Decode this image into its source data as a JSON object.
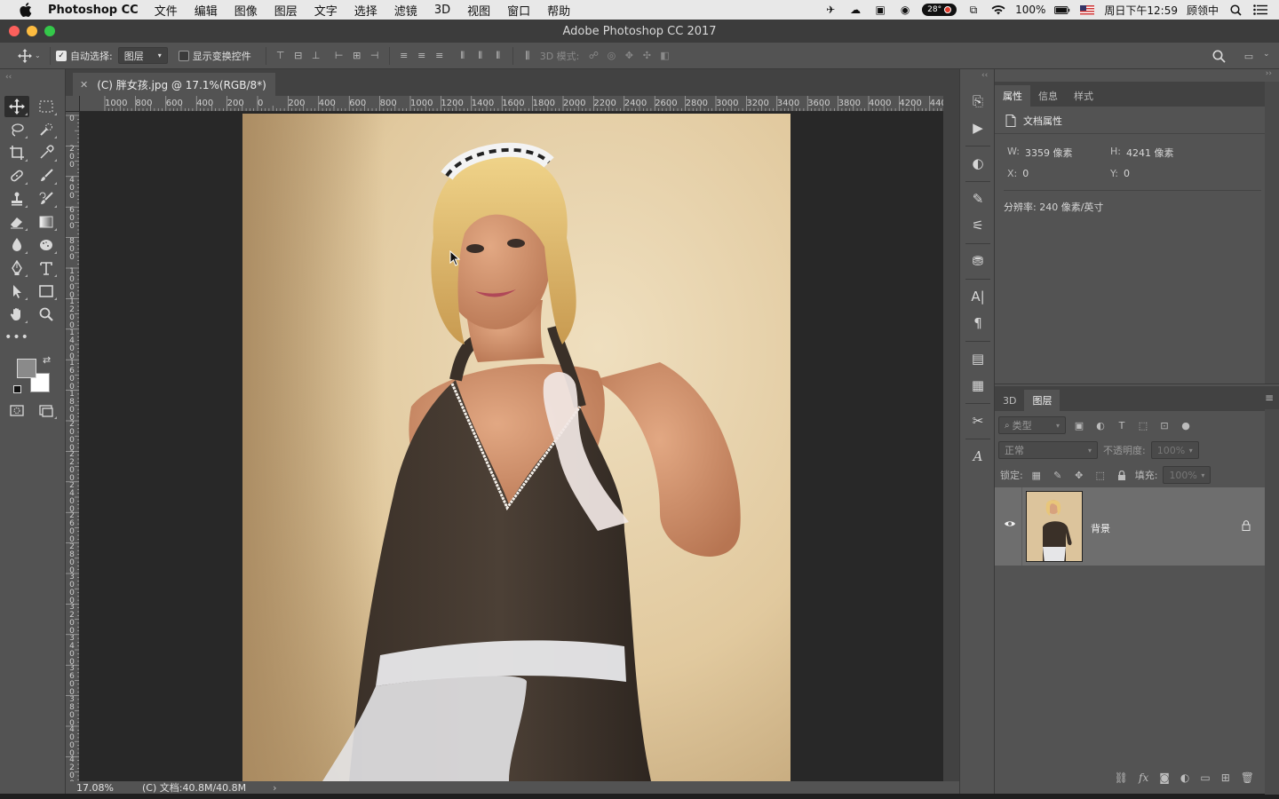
{
  "menubar": {
    "app_name": "Photoshop CC",
    "items": [
      "文件",
      "编辑",
      "图像",
      "图层",
      "文字",
      "选择",
      "滤镜",
      "3D",
      "视图",
      "窗口",
      "帮助"
    ],
    "temperature": "28°",
    "battery": "100%",
    "clock": "周日下午12:59",
    "user": "顾领中"
  },
  "window": {
    "title": "Adobe Photoshop CC 2017"
  },
  "options": {
    "auto_select_label": "自动选择:",
    "auto_select_checked": true,
    "auto_select_target": "图层",
    "show_transform_label": "显示变换控件",
    "mode_3d_label": "3D 模式:"
  },
  "document": {
    "tab_title": "(C) 胖女孩.jpg @ 17.1%(RGB/8*)",
    "zoom": "17.08%",
    "doc_info": "(C) 文档:40.8M/40.8M"
  },
  "ruler": {
    "h_labels": [
      "1000",
      "800",
      "600",
      "400",
      "200",
      "0",
      "200",
      "400",
      "600",
      "800",
      "1000",
      "1200",
      "1400",
      "1600",
      "1800",
      "2000",
      "2200",
      "2400",
      "2600",
      "2800",
      "3000",
      "3200",
      "3400",
      "3600",
      "3800",
      "4000",
      "4200",
      "440"
    ]
  },
  "properties": {
    "tabs": [
      "属性",
      "信息",
      "样式"
    ],
    "active_tab": "属性",
    "section_title": "文档属性",
    "width_label": "W:",
    "width_value": "3359 像素",
    "height_label": "H:",
    "height_value": "4241 像素",
    "x_label": "X:",
    "x_value": "0",
    "y_label": "Y:",
    "y_value": "0",
    "resolution": "分辨率: 240 像素/英寸"
  },
  "layers": {
    "tabs": [
      "3D",
      "图层"
    ],
    "active_tab": "图层",
    "filter_kind": "类型",
    "blend_mode": "正常",
    "opacity_label": "不透明度:",
    "opacity_value": "100%",
    "lock_label": "锁定:",
    "fill_label": "填充:",
    "fill_value": "100%",
    "items": [
      {
        "name": "背景",
        "visible": true,
        "locked": true
      }
    ]
  },
  "colors": {
    "accent_red": "#fc605c",
    "accent_yellow": "#fdbc40",
    "accent_green": "#34c84a",
    "panel_bg": "#535353",
    "canvas_bg": "#282828"
  }
}
